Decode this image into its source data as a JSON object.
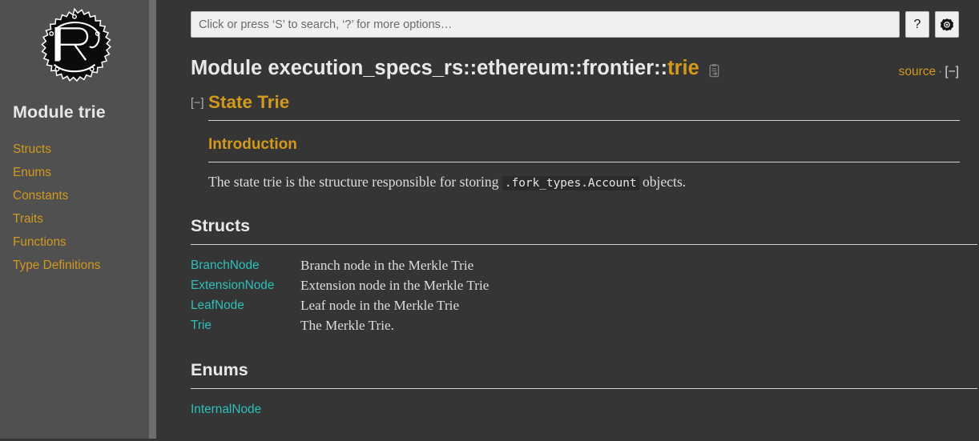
{
  "sidebar": {
    "logo_icon": "rust-logo-gear",
    "title": "Module trie",
    "items": [
      {
        "label": "Structs"
      },
      {
        "label": "Enums"
      },
      {
        "label": "Constants"
      },
      {
        "label": "Traits"
      },
      {
        "label": "Functions"
      },
      {
        "label": "Type Definitions"
      }
    ]
  },
  "search": {
    "value": "",
    "placeholder": "Click or press ‘S’ to search, ‘?’ for more options…",
    "help_label": "?",
    "settings_icon": "gear-icon"
  },
  "heading": {
    "prefix": "Module ",
    "path": "execution_specs_rs::ethereum::frontier::",
    "last": "trie",
    "copy_icon": "copy-path-icon",
    "source_label": "source",
    "separator": "·",
    "collapse_label": "[−]"
  },
  "docblock": {
    "toggle_marker": "[−]",
    "h1": "State Trie",
    "h2": "Introduction",
    "paragraph_before": "The state trie is the structure responsible for storing ",
    "paragraph_code": ".fork_types.Account",
    "paragraph_after": " objects."
  },
  "sections": [
    {
      "id": "structs",
      "title": "Structs",
      "items": [
        {
          "name": "BranchNode",
          "desc": "Branch node in the Merkle Trie"
        },
        {
          "name": "ExtensionNode",
          "desc": "Extension node in the Merkle Trie"
        },
        {
          "name": "LeafNode",
          "desc": "Leaf node in the Merkle Trie"
        },
        {
          "name": "Trie",
          "desc": "The Merkle Trie."
        }
      ]
    },
    {
      "id": "enums",
      "title": "Enums",
      "items": [
        {
          "name": "InternalNode",
          "desc": ""
        }
      ]
    }
  ],
  "colors": {
    "sidebar_bg": "#505050",
    "main_bg": "#353535",
    "link_orange": "#d2991d",
    "link_teal": "#2dbfb8",
    "rule": "#d2d2d2",
    "text": "#dddddd"
  }
}
